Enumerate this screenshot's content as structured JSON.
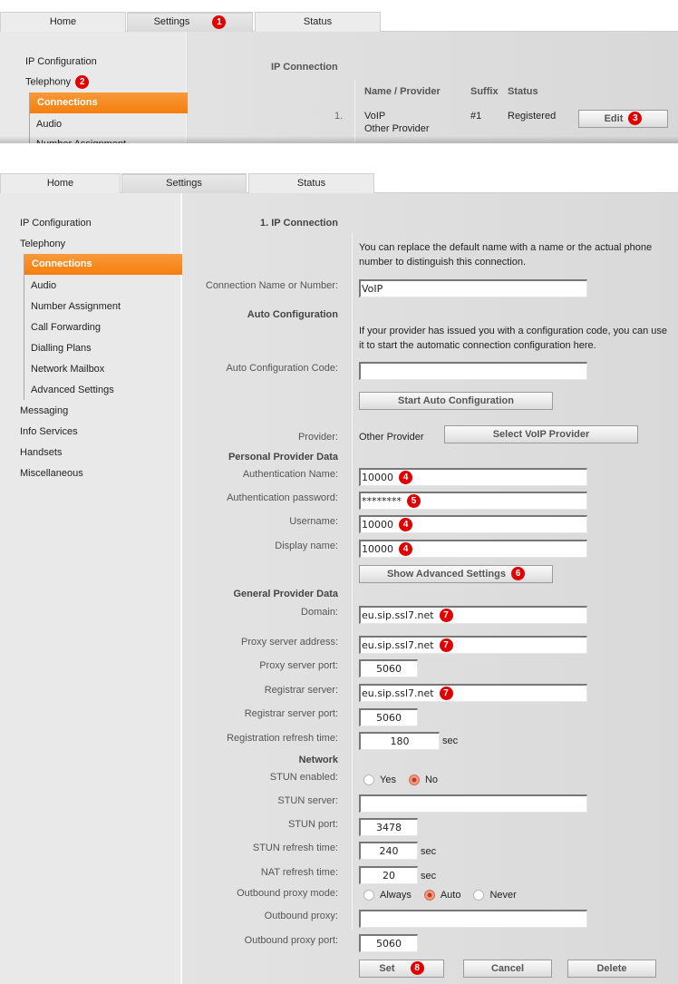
{
  "tabs": [
    {
      "label": "Home"
    },
    {
      "label": "Settings"
    },
    {
      "label": "Status"
    }
  ],
  "sidebar": {
    "items": [
      {
        "label": "IP Configuration"
      },
      {
        "label": "Telephony"
      },
      {
        "label": "Messaging"
      },
      {
        "label": "Info Services"
      },
      {
        "label": "Handsets"
      },
      {
        "label": "Miscellaneous"
      }
    ],
    "telephony_sub": [
      {
        "label": "Connections"
      },
      {
        "label": "Audio"
      },
      {
        "label": "Number Assignment"
      },
      {
        "label": "Call Forwarding"
      },
      {
        "label": "Dialling Plans"
      },
      {
        "label": "Network Mailbox"
      },
      {
        "label": "Advanced Settings"
      }
    ]
  },
  "overview": {
    "section_title": "IP Connection",
    "columns": [
      "Name / Provider",
      "Suffix",
      "Status"
    ],
    "rows": [
      {
        "index": "1.",
        "name": "VoIP",
        "provider": "Other Provider",
        "suffix": "#1",
        "status": "Registered",
        "action": "Edit"
      }
    ]
  },
  "steps": {
    "s1": "1",
    "s2": "2",
    "s3": "3",
    "s4": "4",
    "s5": "5",
    "s6": "6",
    "s7": "7",
    "s8": "8"
  },
  "form": {
    "title": "1. IP Connection",
    "name_note": "You can replace the default name with a name or the actual phone number to distinguish this connection.",
    "connection_name_label": "Connection Name or Number:",
    "connection_name_value": "VoIP",
    "auto_config_section": "Auto Configuration",
    "auto_config_note": "If your provider has issued you with a configuration code, you can use it to start the automatic connection configuration here.",
    "auto_config_code_label": "Auto Configuration Code:",
    "auto_config_code_value": "",
    "start_auto_config_button": "Start Auto Configuration",
    "provider_label": "Provider:",
    "provider_value": "Other Provider",
    "select_provider_button": "Select VoIP Provider",
    "personal_section": "Personal Provider Data",
    "auth_name_label": "Authentication Name:",
    "auth_name_value": "10000",
    "auth_password_label": "Authentication password:",
    "auth_password_value": "********",
    "username_label": "Username:",
    "username_value": "10000",
    "display_name_label": "Display name:",
    "display_name_value": "10000",
    "show_advanced_button": "Show Advanced Settings",
    "general_section": "General Provider Data",
    "domain_label": "Domain:",
    "domain_value": "eu.sip.ssl7.net",
    "proxy_address_label": "Proxy server address:",
    "proxy_address_value": "eu.sip.ssl7.net",
    "proxy_port_label": "Proxy server port:",
    "proxy_port_value": "5060",
    "registrar_label": "Registrar server:",
    "registrar_value": "eu.sip.ssl7.net",
    "registrar_port_label": "Registrar server port:",
    "registrar_port_value": "5060",
    "reg_refresh_label": "Registration refresh time:",
    "reg_refresh_value": "180",
    "unit_sec": "sec",
    "network_section": "Network",
    "stun_enabled_label": "STUN enabled:",
    "stun_options": [
      "Yes",
      "No"
    ],
    "stun_selected": "No",
    "stun_server_label": "STUN server:",
    "stun_server_value": "",
    "stun_port_label": "STUN port:",
    "stun_port_value": "3478",
    "stun_refresh_label": "STUN refresh time:",
    "stun_refresh_value": "240",
    "nat_refresh_label": "NAT refresh time:",
    "nat_refresh_value": "20",
    "outbound_mode_label": "Outbound proxy mode:",
    "outbound_mode_options": [
      "Always",
      "Auto",
      "Never"
    ],
    "outbound_mode_selected": "Auto",
    "outbound_proxy_label": "Outbound proxy:",
    "outbound_proxy_value": "",
    "outbound_port_label": "Outbound proxy port:",
    "outbound_port_value": "5060",
    "set_button": "Set",
    "cancel_button": "Cancel",
    "delete_button": "Delete"
  },
  "colors": {
    "accent_orange": "#f57e0c",
    "step_badge": "#e00000"
  }
}
